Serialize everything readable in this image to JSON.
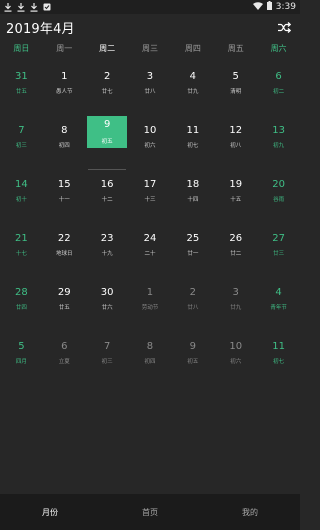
{
  "status_bar": {
    "time": "3:39",
    "left_icons": [
      "download-icon",
      "download-icon",
      "download-icon",
      "app-icon"
    ],
    "right_icons": [
      "wifi-icon",
      "battery-icon"
    ]
  },
  "header": {
    "title": "2019年4月",
    "shuffle_icon": "shuffle-icon"
  },
  "weekdays": [
    "周日",
    "周一",
    "周二",
    "周三",
    "周四",
    "周五",
    "周六"
  ],
  "current_weekday_index": 2,
  "selected": {
    "row": 1,
    "col": 2
  },
  "weeks": [
    [
      {
        "day": "31",
        "lunar": "廿五",
        "other": false
      },
      {
        "day": "1",
        "lunar": "愚人节",
        "other": false
      },
      {
        "day": "2",
        "lunar": "廿七",
        "other": false
      },
      {
        "day": "3",
        "lunar": "廿八",
        "other": false
      },
      {
        "day": "4",
        "lunar": "廿九",
        "other": false
      },
      {
        "day": "5",
        "lunar": "清明",
        "other": false
      },
      {
        "day": "6",
        "lunar": "初二",
        "other": false
      }
    ],
    [
      {
        "day": "7",
        "lunar": "初三",
        "other": false
      },
      {
        "day": "8",
        "lunar": "初四",
        "other": false
      },
      {
        "day": "9",
        "lunar": "初五",
        "other": false
      },
      {
        "day": "10",
        "lunar": "初六",
        "other": false
      },
      {
        "day": "11",
        "lunar": "初七",
        "other": false
      },
      {
        "day": "12",
        "lunar": "初八",
        "other": false
      },
      {
        "day": "13",
        "lunar": "初九",
        "other": false
      }
    ],
    [
      {
        "day": "14",
        "lunar": "初十",
        "other": false
      },
      {
        "day": "15",
        "lunar": "十一",
        "other": false
      },
      {
        "day": "16",
        "lunar": "十二",
        "other": false
      },
      {
        "day": "17",
        "lunar": "十三",
        "other": false
      },
      {
        "day": "18",
        "lunar": "十四",
        "other": false
      },
      {
        "day": "19",
        "lunar": "十五",
        "other": false
      },
      {
        "day": "20",
        "lunar": "谷雨",
        "other": false
      }
    ],
    [
      {
        "day": "21",
        "lunar": "十七",
        "other": false
      },
      {
        "day": "22",
        "lunar": "地球日",
        "other": false
      },
      {
        "day": "23",
        "lunar": "十九",
        "other": false
      },
      {
        "day": "24",
        "lunar": "二十",
        "other": false
      },
      {
        "day": "25",
        "lunar": "廿一",
        "other": false
      },
      {
        "day": "26",
        "lunar": "廿二",
        "other": false
      },
      {
        "day": "27",
        "lunar": "廿三",
        "other": false
      }
    ],
    [
      {
        "day": "28",
        "lunar": "廿四",
        "other": false
      },
      {
        "day": "29",
        "lunar": "廿五",
        "other": false
      },
      {
        "day": "30",
        "lunar": "廿六",
        "other": false
      },
      {
        "day": "1",
        "lunar": "劳动节",
        "other": true
      },
      {
        "day": "2",
        "lunar": "廿八",
        "other": true
      },
      {
        "day": "3",
        "lunar": "廿九",
        "other": true
      },
      {
        "day": "4",
        "lunar": "青年节",
        "other": true
      }
    ],
    [
      {
        "day": "5",
        "lunar": "四月",
        "other": true
      },
      {
        "day": "6",
        "lunar": "立夏",
        "other": true
      },
      {
        "day": "7",
        "lunar": "初三",
        "other": true
      },
      {
        "day": "8",
        "lunar": "初四",
        "other": true
      },
      {
        "day": "9",
        "lunar": "初五",
        "other": true
      },
      {
        "day": "10",
        "lunar": "初六",
        "other": true
      },
      {
        "day": "11",
        "lunar": "初七",
        "other": true
      }
    ]
  ],
  "bottom_nav": [
    {
      "label": "月份",
      "active": true
    },
    {
      "label": "首页",
      "active": false
    },
    {
      "label": "我的",
      "active": false
    }
  ],
  "colors": {
    "background": "#272727",
    "accent": "#3fbf86",
    "nav_background": "#1b1b1b"
  }
}
